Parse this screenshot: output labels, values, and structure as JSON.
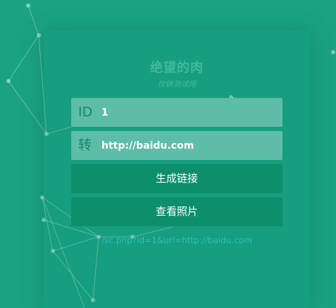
{
  "header": {
    "title": "绝望的肉",
    "subtitle": "仅做测试用"
  },
  "form": {
    "id_field": {
      "prefix": "ID",
      "value": "1"
    },
    "url_field": {
      "prefix": "转",
      "value": "http://baidu.com"
    },
    "generate_button_label": "生成链接",
    "view_button_label": "查看照片"
  },
  "result": {
    "link_text": "/sc.php?id=1&url=http://baidu.com"
  },
  "colors": {
    "background": "#1aa283",
    "field_bg": "#5ebda7",
    "button_bg": "#0d8f6c",
    "link": "#2cc0bd"
  }
}
